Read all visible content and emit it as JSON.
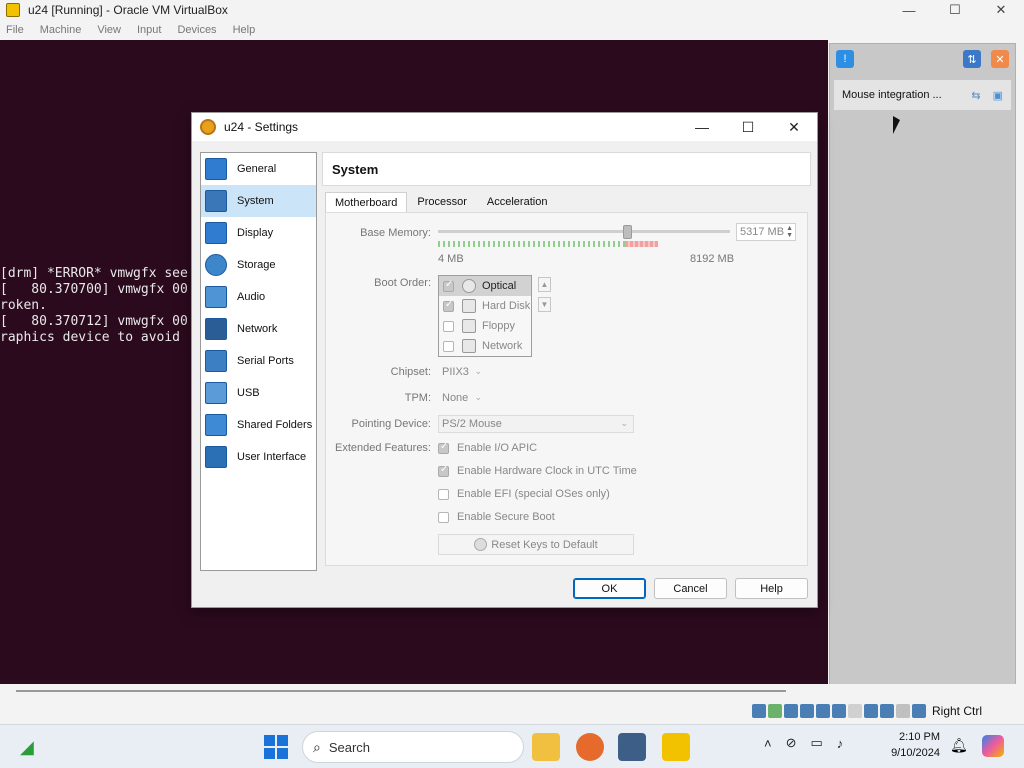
{
  "host": {
    "title": "u24 [Running] - Oracle VM VirtualBox",
    "menu": [
      "File",
      "Machine",
      "View",
      "Input",
      "Devices",
      "Help"
    ],
    "controls": {
      "minimize": "—",
      "maximize": "☐",
      "close": "✕"
    },
    "host_key": "Right Ctrl"
  },
  "console": {
    "lines": [
      "[drm] *ERROR* vmwgfx see",
      "[   80.370700] vmwgfx 00",
      "roken.",
      "[   80.370712] vmwgfx 00",
      "raphics device to avoid"
    ]
  },
  "notification": {
    "text": "Mouse integration ..."
  },
  "dialog": {
    "title": "u24 - Settings",
    "controls": {
      "minimize": "—",
      "maximize": "☐",
      "close": "✕"
    },
    "nav": [
      {
        "label": "General",
        "icon": "general-icon"
      },
      {
        "label": "System",
        "icon": "system-icon",
        "selected": true
      },
      {
        "label": "Display",
        "icon": "display-icon"
      },
      {
        "label": "Storage",
        "icon": "storage-icon"
      },
      {
        "label": "Audio",
        "icon": "audio-icon"
      },
      {
        "label": "Network",
        "icon": "network-icon"
      },
      {
        "label": "Serial Ports",
        "icon": "serial-ports-icon"
      },
      {
        "label": "USB",
        "icon": "usb-icon"
      },
      {
        "label": "Shared Folders",
        "icon": "shared-folders-icon"
      },
      {
        "label": "User Interface",
        "icon": "user-interface-icon"
      }
    ],
    "section_title": "System",
    "tabs": [
      "Motherboard",
      "Processor",
      "Acceleration"
    ],
    "active_tab": "Motherboard",
    "motherboard": {
      "base_memory_label": "Base Memory:",
      "base_memory_value": "5317 MB",
      "base_memory_min": "4 MB",
      "base_memory_max": "8192 MB",
      "base_memory_mb": 5317,
      "memory_range_mb": [
        4,
        8192
      ],
      "boot_order_label": "Boot Order:",
      "boot_order": [
        {
          "label": "Optical",
          "checked": true,
          "selected": true
        },
        {
          "label": "Hard Disk",
          "checked": true
        },
        {
          "label": "Floppy",
          "checked": false
        },
        {
          "label": "Network",
          "checked": false
        }
      ],
      "chipset_label": "Chipset:",
      "chipset_value": "PIIX3",
      "tpm_label": "TPM:",
      "tpm_value": "None",
      "pointing_label": "Pointing Device:",
      "pointing_value": "PS/2 Mouse",
      "extended_label": "Extended Features:",
      "features": [
        {
          "label": "Enable I/O APIC",
          "checked": true
        },
        {
          "label": "Enable Hardware Clock in UTC Time",
          "checked": true
        },
        {
          "label": "Enable EFI (special OSes only)",
          "checked": false
        },
        {
          "label": "Enable Secure Boot",
          "checked": false
        }
      ],
      "reset_keys_label": "Reset Keys to Default"
    },
    "buttons": {
      "ok": "OK",
      "cancel": "Cancel",
      "help": "Help"
    }
  },
  "taskbar": {
    "search_label": "Search",
    "time": "2:10 PM",
    "date": "9/10/2024"
  }
}
